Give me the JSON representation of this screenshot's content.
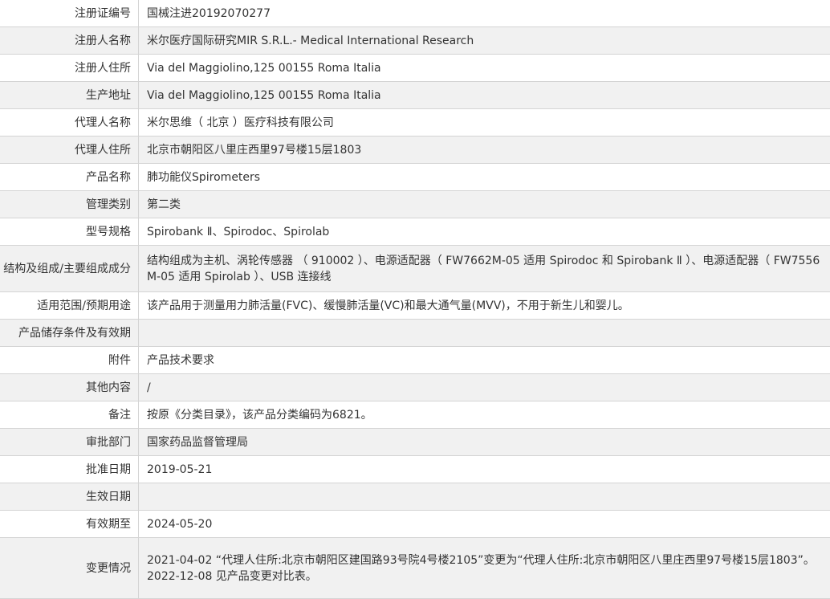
{
  "rows": [
    {
      "label": "注册证编号",
      "value": "国械注进20192070277"
    },
    {
      "label": "注册人名称",
      "value": "米尔医疗国际研究MIR S.R.L.- Medical International Research"
    },
    {
      "label": "注册人住所",
      "value": "Via del Maggiolino,125 00155 Roma Italia"
    },
    {
      "label": "生产地址",
      "value": "Via del Maggiolino,125 00155 Roma Italia"
    },
    {
      "label": "代理人名称",
      "value": "米尔思维（ 北京 ）医疗科技有限公司"
    },
    {
      "label": "代理人住所",
      "value": "北京市朝阳区八里庄西里97号楼15层1803"
    },
    {
      "label": "产品名称",
      "value": "肺功能仪Spirometers"
    },
    {
      "label": "管理类别",
      "value": "第二类"
    },
    {
      "label": "型号规格",
      "value": "Spirobank Ⅱ、Spirodoc、Spirolab"
    },
    {
      "label": "结构及组成/主要组成成分",
      "value": "结构组成为主机、涡轮传感器 （ 910002 ）、电源适配器（ FW7662M-05 适用 Spirodoc 和 Spirobank Ⅱ ）、电源适配器（ FW7556M-05 适用 Spirolab ）、USB 连接线"
    },
    {
      "label": "适用范围/预期用途",
      "value": "该产品用于测量用力肺活量(FVC)、缓慢肺活量(VC)和最大通气量(MVV)，不用于新生儿和婴儿。"
    },
    {
      "label": "产品储存条件及有效期",
      "value": ""
    },
    {
      "label": "附件",
      "value": "产品技术要求"
    },
    {
      "label": "其他内容",
      "value": "/"
    },
    {
      "label": "备注",
      "value": "按原《分类目录》，该产品分类编码为6821。"
    },
    {
      "label": "审批部门",
      "value": "国家药品监督管理局"
    },
    {
      "label": "批准日期",
      "value": "2019-05-21"
    },
    {
      "label": "生效日期",
      "value": ""
    },
    {
      "label": "有效期至",
      "value": "2024-05-20"
    },
    {
      "label": "变更情况",
      "value_lines": [
        "2021-04-02 “代理人住所:北京市朝阳区建国路93号院4号楼2105”变更为“代理人住所:北京市朝阳区八里庄西里97号楼15层1803”。",
        "2022-12-08 见产品变更对比表。"
      ]
    }
  ]
}
